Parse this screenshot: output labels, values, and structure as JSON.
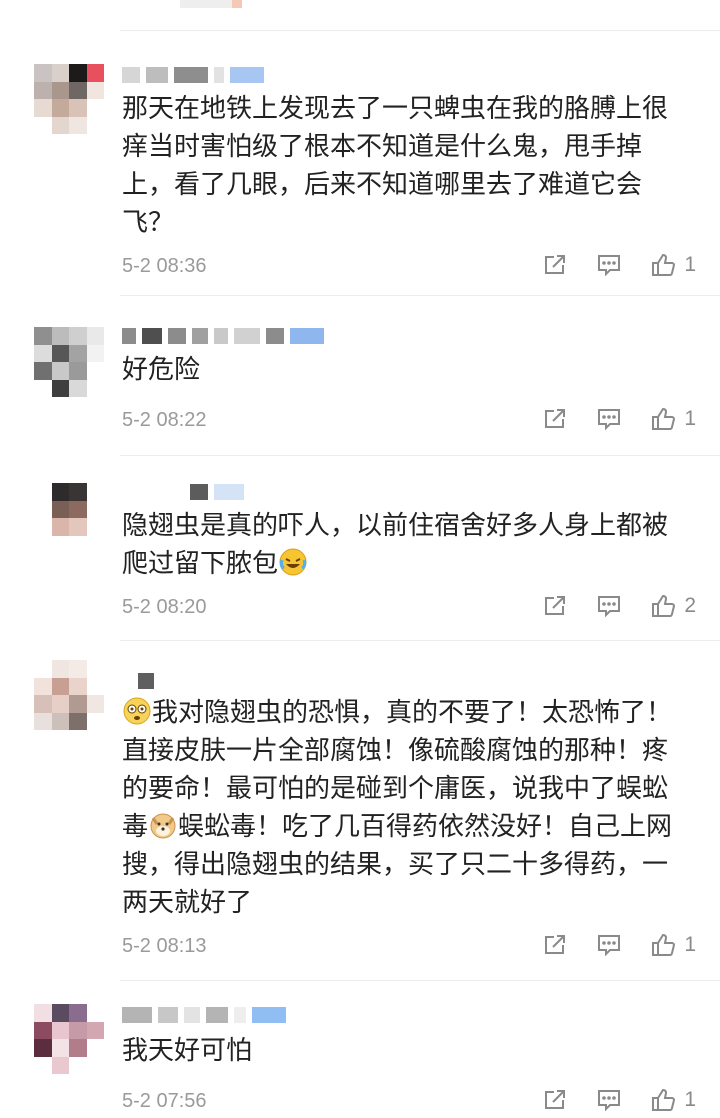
{
  "comments": [
    {
      "text": "那天在地铁上发现去了一只蜱虫在我的胳膊上很痒当时害怕级了根本不知道是什么鬼，甩手掉上，看了几眼，后来不知道哪里去了难道它会飞？",
      "time": "5-2 08:36",
      "likes": "1"
    },
    {
      "text": "好危险",
      "time": "5-2 08:22",
      "likes": "1"
    },
    {
      "text_before": "隐翅虫是真的吓人，以前住宿舍好多人身上都被爬过留下脓包",
      "emoji": "laughing-crying-emoji",
      "time": "5-2 08:20",
      "likes": "2"
    },
    {
      "p1": "我对隐翅虫的恐惧，真的不要了！太恐怖了！直接皮肤一片全部腐蚀！像硫酸腐蚀的那种！疼的要命！最可怕的是碰到个庸医，说我中了蜈蚣毒",
      "p2": "蜈蚣毒！吃了几百得药依然没好！自己上网搜，得出隐翅虫的结果，买了只二十多得药，一两天就好了",
      "emoji_lead": "dizzy-face-emoji",
      "emoji_mid": "doge-emoji",
      "time": "5-2 08:13",
      "likes": "1"
    },
    {
      "text": "我天好可怕",
      "time": "5-2 07:56",
      "likes": "1"
    }
  ],
  "icons": {
    "share": "share-icon",
    "reply": "reply-icon",
    "like": "thumbs-up-icon"
  },
  "colors": {
    "text": "#222222",
    "meta": "#9a9a9a",
    "icon": "#8a8a8a"
  }
}
